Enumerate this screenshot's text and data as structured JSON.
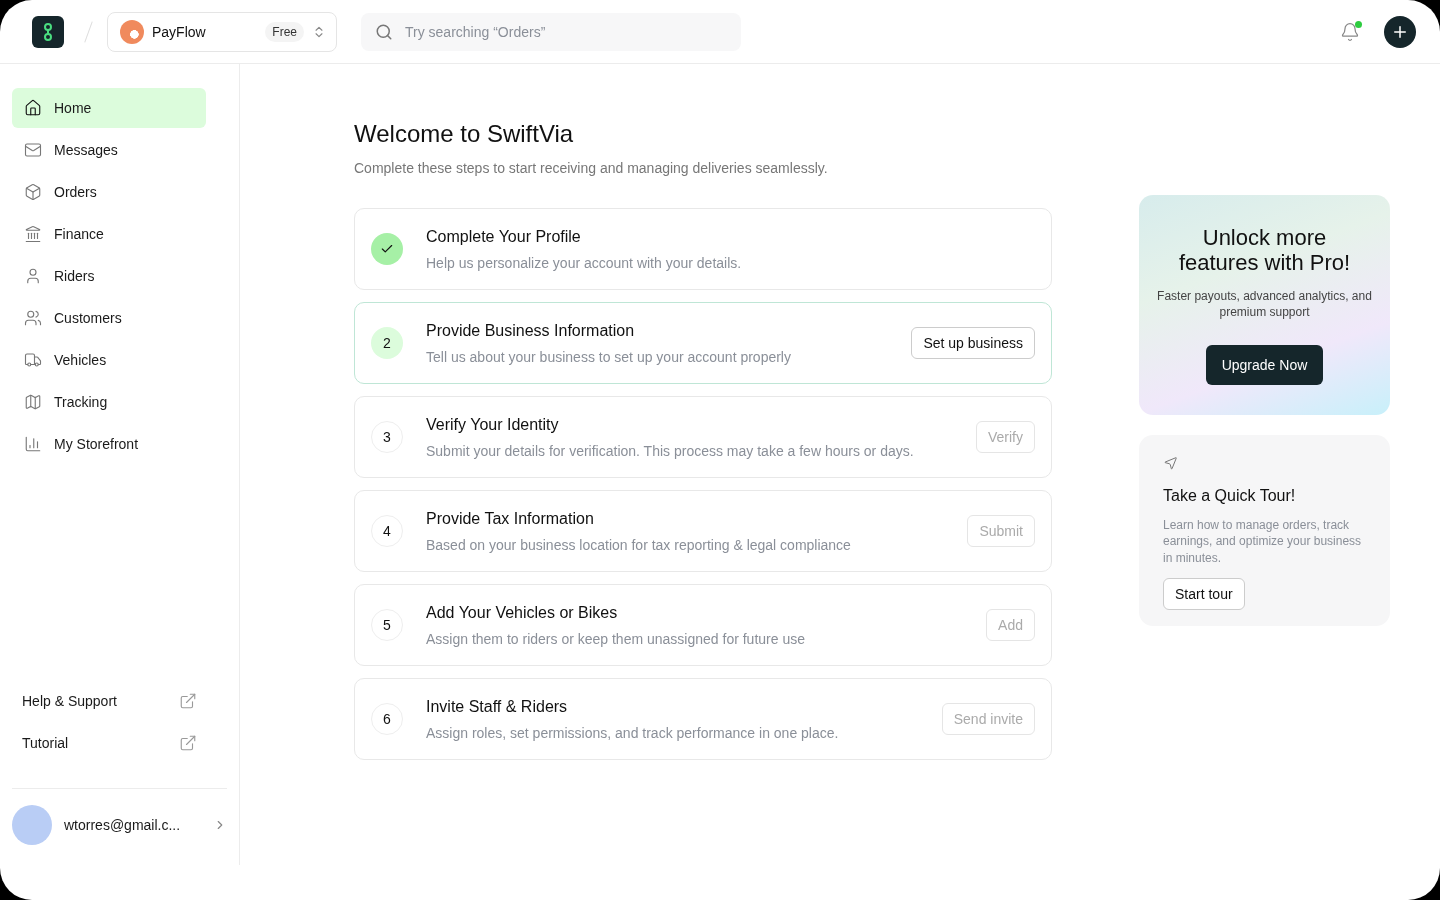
{
  "header": {
    "workspace": {
      "name": "PayFlow",
      "plan": "Free"
    },
    "search": {
      "placeholder": "Try searching “Orders”"
    },
    "notifications": {
      "unread": true
    }
  },
  "sidebar": {
    "items": [
      {
        "label": "Home",
        "selected": true
      },
      {
        "label": "Messages",
        "selected": false
      },
      {
        "label": "Orders",
        "selected": false
      },
      {
        "label": "Finance",
        "selected": false
      },
      {
        "label": "Riders",
        "selected": false
      },
      {
        "label": "Customers",
        "selected": false
      },
      {
        "label": "Vehicles",
        "selected": false
      },
      {
        "label": "Tracking",
        "selected": false
      },
      {
        "label": "My Storefront",
        "selected": false
      }
    ],
    "links": [
      {
        "label": "Help & Support"
      },
      {
        "label": "Tutorial"
      }
    ],
    "user": {
      "email": "wtorres@gmail.c..."
    }
  },
  "main": {
    "title": "Welcome to SwiftVia",
    "subtitle": "Complete these steps to start receiving and managing deliveries seamlessly.",
    "steps": [
      {
        "completed": true,
        "selected": false,
        "title": "Complete Your Profile",
        "description": "Help us personalize your account with your details."
      },
      {
        "completed": false,
        "selected": true,
        "number": "2",
        "title": "Provide Business Information",
        "description": "Tell us about your business to set up your account properly",
        "action": "Set up business"
      },
      {
        "completed": false,
        "selected": false,
        "number": "3",
        "title": "Verify Your Identity",
        "description": "Submit your details for verification. This process may take a few hours or days.",
        "action": "Verify"
      },
      {
        "completed": false,
        "selected": false,
        "number": "4",
        "title": "Provide Tax Information",
        "description": "Based on your business location for tax reporting & legal compliance",
        "action": "Submit"
      },
      {
        "completed": false,
        "selected": false,
        "number": "5",
        "title": "Add Your Vehicles or Bikes",
        "description": "Assign them to riders or keep them unassigned for future use",
        "action": "Add"
      },
      {
        "completed": false,
        "selected": false,
        "number": "6",
        "title": "Invite Staff & Riders",
        "description": "Assign roles, set permissions, and track performance in one place.",
        "action": "Send invite"
      }
    ]
  },
  "promo": {
    "title": "Unlock more features with Pro!",
    "text": "Faster payouts, advanced analytics, and premium support",
    "button": "Upgrade Now"
  },
  "tour": {
    "title": "Take a Quick Tour!",
    "text": "Learn how to manage orders, track earnings, and optimize your business in minutes.",
    "button": "Start tour"
  }
}
